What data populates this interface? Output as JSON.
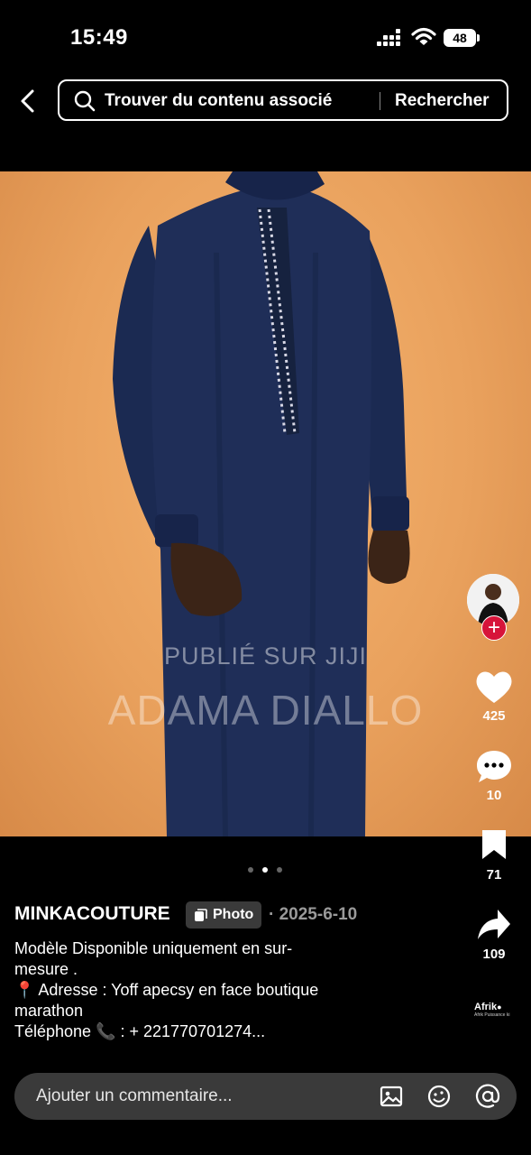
{
  "status_bar": {
    "time": "15:49",
    "battery": "48"
  },
  "search": {
    "placeholder": "Trouver du contenu associé",
    "button": "Rechercher"
  },
  "photo": {
    "watermark_top": "PUBLIÉ SUR JIJI",
    "watermark_bottom": "ADAMA DIALLO",
    "page_indicator": {
      "total": 3,
      "active": 2
    }
  },
  "actions": {
    "likes": "425",
    "comments": "10",
    "saves": "71",
    "shares": "109"
  },
  "post": {
    "author": "MINKACOUTURE",
    "tag": "Photo",
    "date": "· 2025-6-10",
    "caption_lines": [
      "Modèle Disponible uniquement en sur-",
      "mesure .",
      "📍  Adresse : Yoff apecsy en face boutique",
      "marathon",
      "Téléphone 📞 : + 221770701274..."
    ]
  },
  "brand_badge": {
    "name": "Afrik",
    "sub": "Afrik Puissance ki"
  },
  "comment": {
    "placeholder": "Ajouter un commentaire..."
  },
  "colors": {
    "follow_badge": "#d7143a",
    "garment": "#1c2a4e",
    "backdrop": "#eea764"
  }
}
